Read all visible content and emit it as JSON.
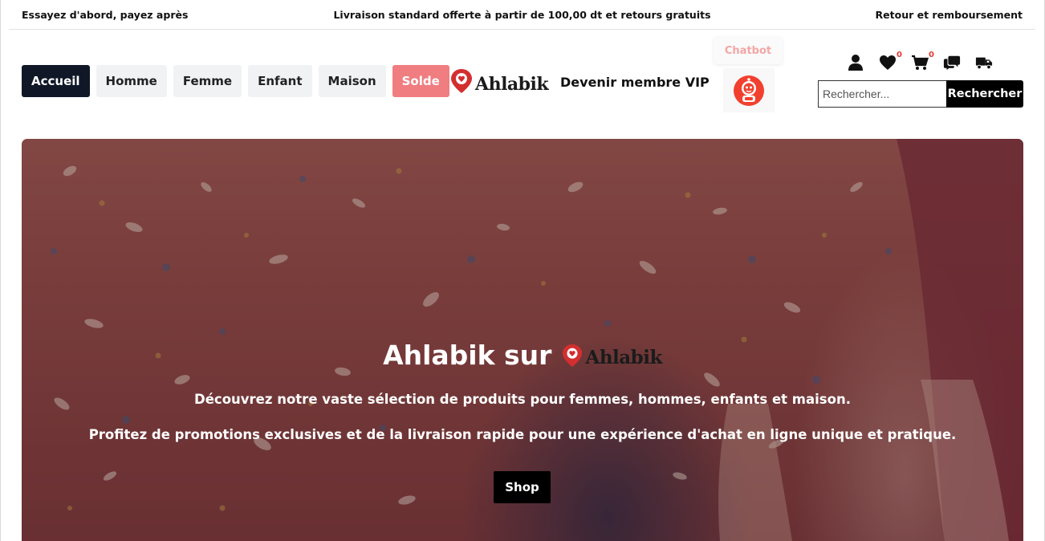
{
  "topbar": {
    "left": "Essayez d'abord, payez après",
    "center": "Livraison standard offerte à partir de 100,00 dt et retours gratuits",
    "right": "Retour et remboursement"
  },
  "nav": {
    "items": [
      {
        "label": "Accueil"
      },
      {
        "label": "Homme"
      },
      {
        "label": "Femme"
      },
      {
        "label": "Enfant"
      },
      {
        "label": "Maison"
      },
      {
        "label": "Solde"
      }
    ]
  },
  "brand": {
    "name": "Ahlabik",
    "accent": "#d32f2f"
  },
  "vip": {
    "label": "Devenir membre VIP"
  },
  "chatbot": {
    "label": "Chatbot",
    "color": "#f4a6a6",
    "icon": "robot-icon"
  },
  "icons": {
    "wishlist_count": "0",
    "cart_count": "0"
  },
  "search": {
    "placeholder": "Rechercher...",
    "button": "Rechercher"
  },
  "hero": {
    "title_prefix": "Ahlabik sur",
    "line1": "Découvrez notre vaste sélection de produits pour femmes, hommes, enfants et maison.",
    "line2": "Profitez de promotions exclusives et de la livraison rapide pour une expérience d'achat en ligne unique et pratique.",
    "cta": "Shop"
  }
}
